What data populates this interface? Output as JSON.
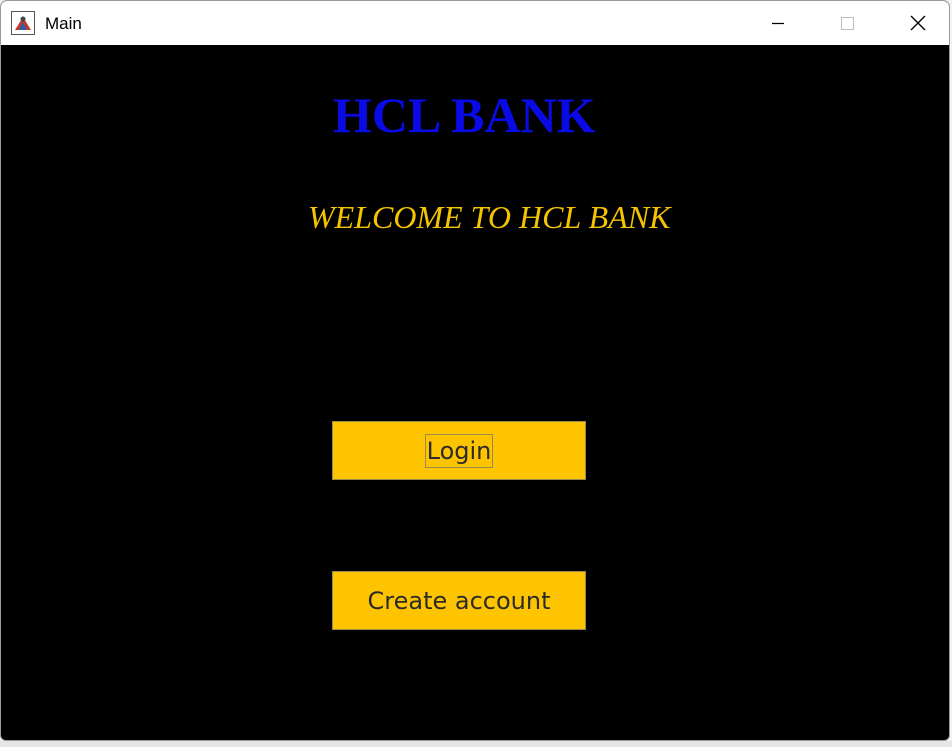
{
  "window": {
    "title": "Main",
    "icons": {
      "app": "java-app-icon",
      "minimize": "minimize-icon",
      "maximize": "maximize-icon",
      "close": "close-icon"
    }
  },
  "main": {
    "bank_title": "HCL BANK",
    "welcome": "WELCOME TO HCL BANK",
    "login_button": "Login",
    "create_account_button": "Create account"
  },
  "colors": {
    "background": "#000000",
    "title": "#0a0ae6",
    "welcome": "#f5c400",
    "button": "#ffc400"
  }
}
